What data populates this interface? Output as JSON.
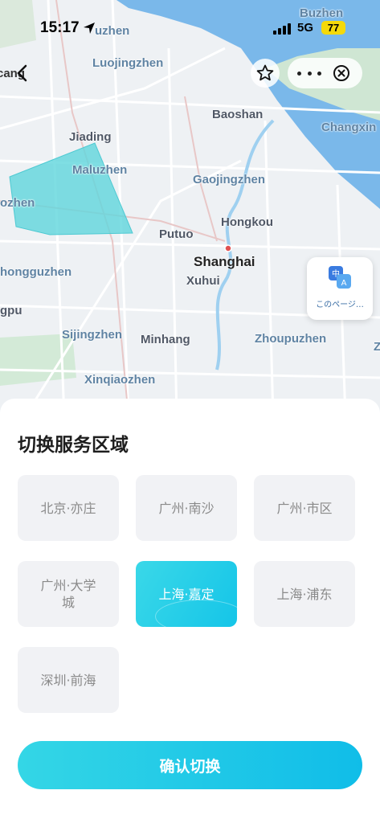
{
  "status_bar": {
    "time": "15:17",
    "network": "5G",
    "battery": "77"
  },
  "nav": {
    "back_label": "cang"
  },
  "map": {
    "labels": {
      "buzhen": "Buzhen",
      "zhen_top": "uzhen",
      "luojingzhen": "Luojingzhen",
      "baoshan": "Baoshan",
      "changxing": "Changxin",
      "jiading": "Jiading",
      "maluzhen": "Maluzhen",
      "gaojingzhen": "Gaojingzhen",
      "ozhen": "ozhen",
      "hongkou": "Hongkou",
      "putuo": "Putuo",
      "shanghai": "Shanghai",
      "xuhui": "Xuhui",
      "honggu": "honggu",
      "honggu2": "zhen",
      "gpu": "gpu",
      "sijingzhen": "Sijingzhen",
      "minhang": "Minhang",
      "zhoupuzhen": "Zhoupuzhen",
      "z": "Z",
      "xinqiaozhen": "Xinqiaozhen"
    }
  },
  "translate": {
    "label": "このページ…"
  },
  "sheet": {
    "title": "切换服务区域",
    "regions": [
      {
        "label": "北京·亦庄",
        "selected": false
      },
      {
        "label": "广州·南沙",
        "selected": false
      },
      {
        "label": "广州·市区",
        "selected": false
      },
      {
        "label": "广州·大学城",
        "selected": false
      },
      {
        "label": "上海·嘉定",
        "selected": true
      },
      {
        "label": "上海·浦东",
        "selected": false
      },
      {
        "label": "深圳·前海",
        "selected": false
      }
    ],
    "confirm_label": "确认切换"
  },
  "colors": {
    "accent": "#15c5e8",
    "service_area": "#5fd6dc",
    "water": "#7ab8ea",
    "region_bg": "#f1f2f5"
  }
}
